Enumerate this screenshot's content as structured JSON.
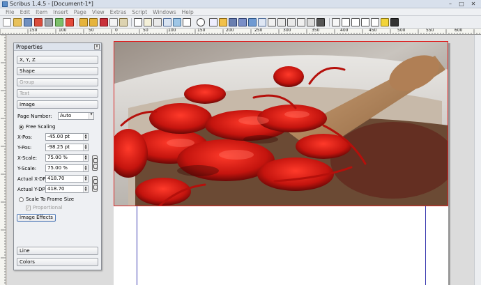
{
  "window": {
    "title": "Scribus 1.4.5 - [Document-1*]",
    "minimize": "–",
    "maximize": "□",
    "close": "✕"
  },
  "menu": [
    "File",
    "Edit",
    "Item",
    "Insert",
    "Page",
    "View",
    "Extras",
    "Script",
    "Windows",
    "Help"
  ],
  "ruler": {
    "top_labels": [
      "150",
      "100",
      "50",
      "0",
      "50",
      "100",
      "150",
      "200",
      "250",
      "300",
      "350",
      "400",
      "450",
      "500",
      "550",
      "600"
    ],
    "left_labels": [
      "0",
      "50",
      "100",
      "150",
      "200",
      "250",
      "300"
    ]
  },
  "properties": {
    "title": "Properties",
    "close": "x",
    "sections": {
      "xyz": "X, Y, Z",
      "shape": "Shape",
      "group": "Group",
      "text": "Text",
      "image": "Image",
      "line": "Line",
      "colors": "Colors"
    },
    "page_number_label": "Page Number:",
    "page_number_value": "Auto",
    "free_scaling_label": "Free Scaling",
    "x_pos_label": "X-Pos:",
    "x_pos_value": "-45.00 pt",
    "y_pos_label": "Y-Pos:",
    "y_pos_value": "-98.25 pt",
    "x_scale_label": "X-Scale:",
    "x_scale_value": "75.00 %",
    "y_scale_label": "Y-Scale:",
    "y_scale_value": "75.00 %",
    "actual_x_dpi_label": "Actual X-DPI:",
    "actual_x_dpi_value": "418.70",
    "actual_y_dpi_label": "Actual Y-DPI:",
    "actual_y_dpi_value": "418.70",
    "scale_to_frame_label": "Scale To Frame Size",
    "proportional_label": "Proportional",
    "image_effects_label": "Image Effects"
  }
}
